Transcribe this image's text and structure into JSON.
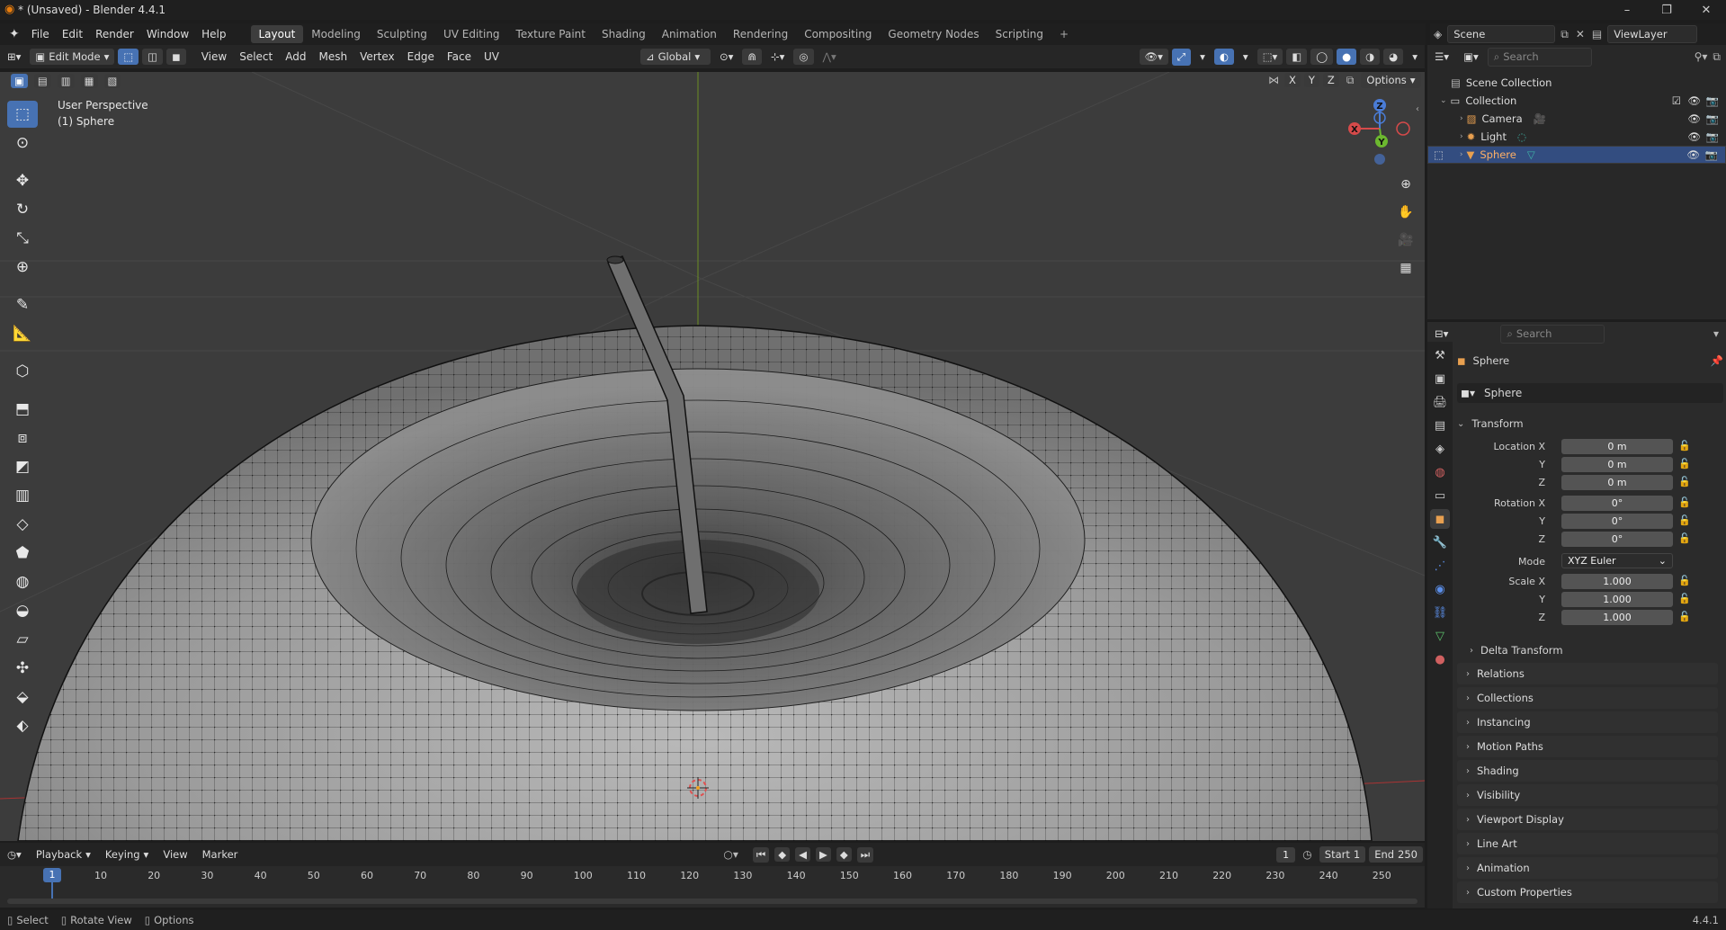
{
  "window": {
    "title": "* (Unsaved) - Blender 4.4.1",
    "controls": [
      "–",
      "❐",
      "✕"
    ]
  },
  "menus": [
    "File",
    "Edit",
    "Render",
    "Window",
    "Help"
  ],
  "workspaces": [
    "Layout",
    "Modeling",
    "Sculpting",
    "UV Editing",
    "Texture Paint",
    "Shading",
    "Animation",
    "Rendering",
    "Compositing",
    "Geometry Nodes",
    "Scripting"
  ],
  "active_workspace": "Layout",
  "scene": {
    "name": "Scene",
    "view_layer": "ViewLayer"
  },
  "viewport_header": {
    "mode": "Edit Mode",
    "menus": [
      "View",
      "Select",
      "Add",
      "Mesh",
      "Vertex",
      "Edge",
      "Face",
      "UV"
    ],
    "orientation": "Global",
    "options": "Options",
    "axes": [
      "X",
      "Y",
      "Z"
    ]
  },
  "viewport_overlay": {
    "line1": "User Perspective",
    "line2": "(1) Sphere"
  },
  "gizmo": {
    "x": "X",
    "y": "Y",
    "z": "Z"
  },
  "outliner": {
    "search_placeholder": "Search",
    "root": "Scene Collection",
    "collection": "Collection",
    "items": [
      "Camera",
      "Light",
      "Sphere"
    ],
    "selected": "Sphere"
  },
  "properties": {
    "search_placeholder": "Search",
    "object_name": "Sphere",
    "data_name": "Sphere",
    "transform_title": "Transform",
    "location_label": "Location X",
    "rotation_label": "Rotation X",
    "scale_label": "Scale X",
    "y_label": "Y",
    "z_label": "Z",
    "location": [
      "0 m",
      "0 m",
      "0 m"
    ],
    "rotation": [
      "0°",
      "0°",
      "0°"
    ],
    "mode_label": "Mode",
    "mode": "XYZ Euler",
    "scale": [
      "1.000",
      "1.000",
      "1.000"
    ],
    "delta": "Delta Transform",
    "panels": [
      "Relations",
      "Collections",
      "Instancing",
      "Motion Paths",
      "Shading",
      "Visibility",
      "Viewport Display",
      "Line Art",
      "Animation",
      "Custom Properties"
    ]
  },
  "timeline": {
    "menus": [
      "Playback",
      "Keying",
      "View",
      "Marker"
    ],
    "current_frame": "1",
    "start_label": "Start",
    "start": "1",
    "end_label": "End",
    "end": "250",
    "ruler": [
      "10",
      "20",
      "30",
      "40",
      "50",
      "60",
      "70",
      "80",
      "90",
      "100",
      "110",
      "120",
      "130",
      "140",
      "150",
      "160",
      "170",
      "180",
      "190",
      "200",
      "210",
      "220",
      "230",
      "240",
      "250"
    ]
  },
  "statusbar": {
    "select": "Select",
    "rotate": "Rotate View",
    "options": "Options",
    "version": "4.4.1"
  },
  "colors": {
    "accent": "#4772b3",
    "selected_row": "#334d80",
    "viewport_bg": "#3c3c3c"
  }
}
